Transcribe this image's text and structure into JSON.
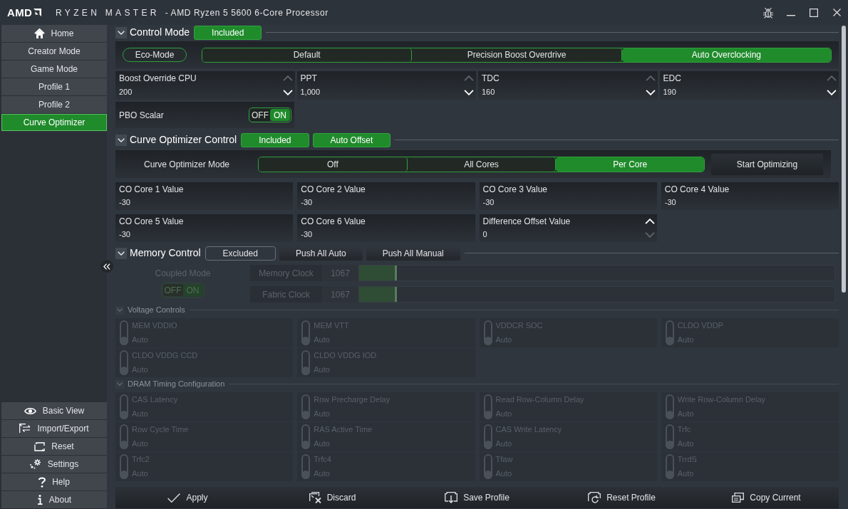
{
  "window": {
    "logo": "AMD",
    "app_name": "RYZEN MASTER",
    "title": "- AMD Ryzen 5 5600 6-Core Processor"
  },
  "sidebar": {
    "top_items": [
      {
        "label": "Home",
        "kind": "home",
        "selected": false
      },
      {
        "label": "Creator Mode",
        "kind": "plain",
        "selected": false
      },
      {
        "label": "Game Mode",
        "kind": "plain",
        "selected": false
      },
      {
        "label": "Profile 1",
        "kind": "plain",
        "selected": false
      },
      {
        "label": "Profile 2",
        "kind": "plain",
        "selected": false
      },
      {
        "label": "Curve Optimizer",
        "kind": "plain",
        "selected": true
      }
    ],
    "bottom_items": [
      {
        "label": "Basic View",
        "kind": "view"
      },
      {
        "label": "Import/Export",
        "kind": "transfer"
      },
      {
        "label": "Reset",
        "kind": "reset"
      },
      {
        "label": "Settings",
        "kind": "settings"
      },
      {
        "label": "Help",
        "kind": "help"
      },
      {
        "label": "About",
        "kind": "about"
      }
    ]
  },
  "control_mode": {
    "title": "Control Mode",
    "expanded": true,
    "badges": [
      {
        "label": "Included",
        "active": true
      }
    ],
    "eco_mode": "Eco-Mode",
    "modes": [
      {
        "label": "Default",
        "selected": false
      },
      {
        "label": "Precision Boost Overdrive",
        "selected": false
      },
      {
        "label": "Auto Overclocking",
        "selected": true
      }
    ],
    "fields": [
      {
        "label": "Boost Override CPU",
        "value": "200",
        "can_increase": false,
        "can_decrease": true
      },
      {
        "label": "PPT",
        "value": "1,000",
        "can_increase": false,
        "can_decrease": true
      },
      {
        "label": "TDC",
        "value": "160",
        "can_increase": false,
        "can_decrease": true
      },
      {
        "label": "EDC",
        "value": "190",
        "can_increase": false,
        "can_decrease": true
      }
    ],
    "pbo_scalar": {
      "label": "PBO Scalar",
      "off_label": "OFF",
      "on_label": "ON",
      "on": true
    }
  },
  "curve_optimizer": {
    "title": "Curve Optimizer Control",
    "expanded": true,
    "badges": [
      {
        "label": "Included",
        "active": true
      },
      {
        "label": "Auto Offset",
        "active": true
      }
    ],
    "mode_label": "Curve Optimizer Mode",
    "modes": [
      {
        "label": "Off",
        "selected": false
      },
      {
        "label": "All Cores",
        "selected": false
      },
      {
        "label": "Per Core",
        "selected": true
      }
    ],
    "start_button": "Start Optimizing",
    "fields": [
      {
        "label": "CO Core 1 Value",
        "value": "-30",
        "kind": "plain"
      },
      {
        "label": "CO Core 2 Value",
        "value": "-30",
        "kind": "plain"
      },
      {
        "label": "CO Core 3 Value",
        "value": "-30",
        "kind": "plain"
      },
      {
        "label": "CO Core 4 Value",
        "value": "-30",
        "kind": "plain"
      },
      {
        "label": "CO Core 5 Value",
        "value": "-30",
        "kind": "plain"
      },
      {
        "label": "CO Core 6 Value",
        "value": "-30",
        "kind": "plain"
      },
      {
        "label": "Difference Offset Value",
        "value": "0",
        "kind": "spinner",
        "can_increase": true,
        "can_decrease": false
      }
    ]
  },
  "memory_control": {
    "title": "Memory Control",
    "expanded": true,
    "badges": [
      {
        "label": "Excluded",
        "active": false
      }
    ],
    "buttons": [
      {
        "label": "Push All Auto"
      },
      {
        "label": "Push All Manual"
      }
    ],
    "coupled_mode": {
      "label": "Coupled Mode",
      "off_label": "OFF",
      "on_label": "ON",
      "on": true,
      "disabled": true
    },
    "clocks": [
      {
        "label": "Memory Clock",
        "value": "1067",
        "level": 0.08,
        "disabled": true
      },
      {
        "label": "Fabric Clock",
        "value": "1067",
        "level": 0.08,
        "disabled": true
      }
    ],
    "voltage_controls": {
      "title": "Voltage Controls",
      "expanded": true,
      "items": [
        {
          "label": "MEM VDDIO",
          "value": "Auto",
          "on": false,
          "disabled": true
        },
        {
          "label": "MEM VTT",
          "value": "Auto",
          "on": false,
          "disabled": true
        },
        {
          "label": "VDDCR SOC",
          "value": "Auto",
          "on": false,
          "disabled": true
        },
        {
          "label": "CLDO VDDP",
          "value": "Auto",
          "on": false,
          "disabled": true
        },
        {
          "label": "CLDO VDDG CCD",
          "value": "Auto",
          "on": false,
          "disabled": true
        },
        {
          "label": "CLDO VDDG IOD",
          "value": "Auto",
          "on": false,
          "disabled": true
        }
      ]
    },
    "dram_timing": {
      "title": "DRAM Timing Configuration",
      "expanded": true,
      "items": [
        {
          "label": "CAS Latency",
          "value": "Auto",
          "on": false,
          "disabled": true
        },
        {
          "label": "Row Precharge Delay",
          "value": "Auto",
          "on": false,
          "disabled": true
        },
        {
          "label": "Read Row-Column Delay",
          "value": "Auto",
          "on": false,
          "disabled": true
        },
        {
          "label": "Write Row-Column Delay",
          "value": "Auto",
          "on": false,
          "disabled": true
        },
        {
          "label": "Row Cycle Time",
          "value": "Auto",
          "on": false,
          "disabled": true
        },
        {
          "label": "RAS Active Time",
          "value": "Auto",
          "on": false,
          "disabled": true
        },
        {
          "label": "CAS Write Latency",
          "value": "Auto",
          "on": false,
          "disabled": true
        },
        {
          "label": "Trfc",
          "value": "Auto",
          "on": false,
          "disabled": true
        },
        {
          "label": "Trfc2",
          "value": "Auto",
          "on": false,
          "disabled": true
        },
        {
          "label": "Trfc4",
          "value": "Auto",
          "on": false,
          "disabled": true
        },
        {
          "label": "Tfaw",
          "value": "Auto",
          "on": false,
          "disabled": true
        },
        {
          "label": "TrrdS",
          "value": "Auto",
          "on": false,
          "disabled": true
        }
      ]
    }
  },
  "action_bar": [
    {
      "label": "Apply",
      "kind": "apply"
    },
    {
      "label": "Discard",
      "kind": "discard"
    },
    {
      "label": "Save Profile",
      "kind": "save"
    },
    {
      "label": "Reset Profile",
      "kind": "reset"
    },
    {
      "label": "Copy Current",
      "kind": "copy"
    }
  ]
}
